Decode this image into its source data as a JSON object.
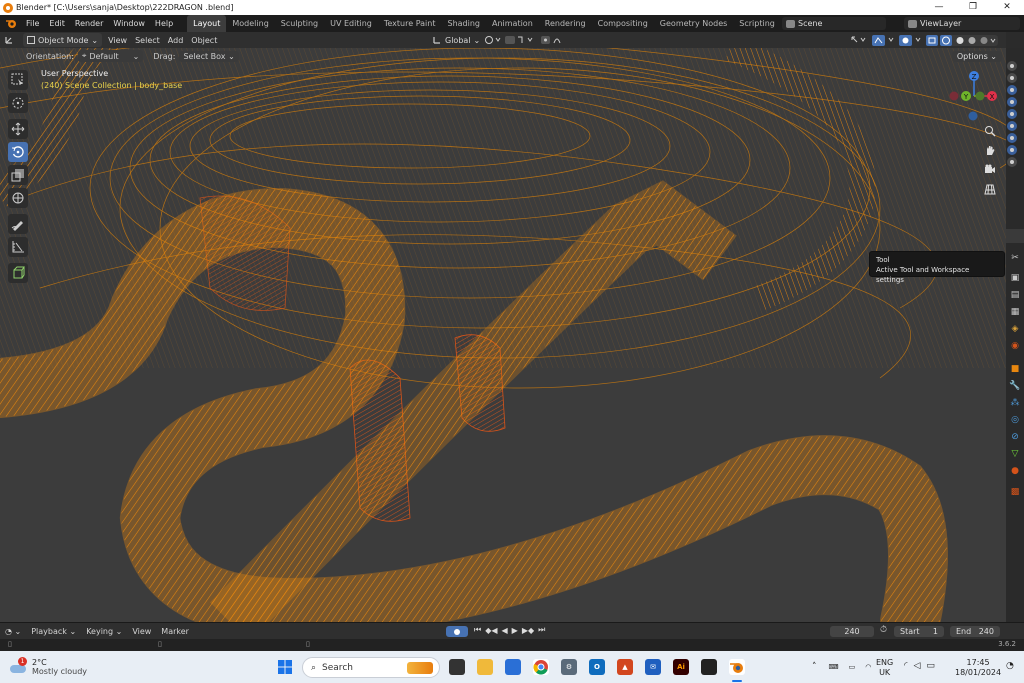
{
  "window": {
    "title": "Blender* [C:\\Users\\sanja\\Desktop\\222DRAGON .blend]",
    "controls": [
      "—",
      "❐",
      "✕"
    ]
  },
  "menus": [
    "File",
    "Edit",
    "Render",
    "Window",
    "Help"
  ],
  "workspaces": [
    "Layout",
    "Modeling",
    "Sculpting",
    "UV Editing",
    "Texture Paint",
    "Shading",
    "Animation",
    "Rendering",
    "Compositing",
    "Geometry Nodes",
    "Scripting"
  ],
  "add_workspace": "+",
  "scene": "Scene",
  "view_layer": "ViewLayer",
  "viewport_header": {
    "mode": "Object Mode",
    "menus": [
      "View",
      "Select",
      "Add",
      "Object"
    ],
    "transform_orientation": "Global"
  },
  "tool_settings": {
    "orientation_label": "Orientation:",
    "orientation_value": "Default",
    "drag_label": "Drag:",
    "drag_value": "Select Box"
  },
  "viewport": {
    "view_name": "User Perspective",
    "collection_info": "(240) Scene Collection | body_base",
    "options_label": "Options"
  },
  "gizmo": {
    "z": "Z",
    "y": "Y",
    "x": "X"
  },
  "tooltip": {
    "title": "Tool",
    "description": "Active Tool and Workspace settings"
  },
  "timeline": {
    "menus": [
      "Playback",
      "Keying",
      "View",
      "Marker"
    ],
    "current_frame": "240",
    "start_label": "Start",
    "start_value": "1",
    "end_label": "End",
    "end_value": "240"
  },
  "version": "3.6.2",
  "taskbar": {
    "weather_temp": "2°C",
    "weather_desc": "Mostly cloudy",
    "weather_badge": "1",
    "search_placeholder": "Search",
    "language": "ENG",
    "region": "UK",
    "time": "17:45",
    "date": "18/01/2024",
    "adobe_label": "Ai"
  },
  "colors": {
    "wire_primary": "#e8870f",
    "wire_secondary": "#d5531a",
    "active_tool": "#4772b3",
    "axis_x": "#e0304a",
    "axis_y": "#6fb52a",
    "axis_z": "#3d7fe0"
  }
}
